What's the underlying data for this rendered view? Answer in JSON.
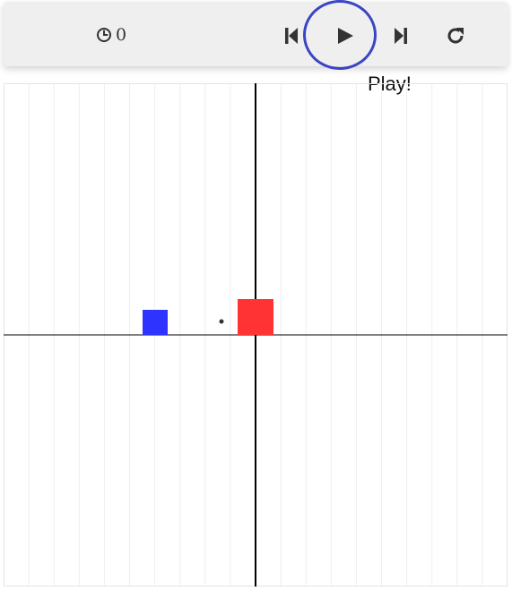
{
  "toolbar": {
    "timer_icon": "clock-icon",
    "time_value": "0",
    "buttons": [
      {
        "name": "step-back",
        "icon": "skip-back-icon"
      },
      {
        "name": "play",
        "icon": "play-icon"
      },
      {
        "name": "step-forward",
        "icon": "skip-forward-icon"
      },
      {
        "name": "reset",
        "icon": "reload-icon"
      }
    ]
  },
  "hint": {
    "label": "Play!",
    "ring_color": "#3b45c4"
  },
  "scene": {
    "grid_color": "#eeeeee",
    "axis_color": "#000000",
    "blue_block_color": "#2f33ff",
    "red_block_color": "#ff3333",
    "point_color": "#333333"
  }
}
